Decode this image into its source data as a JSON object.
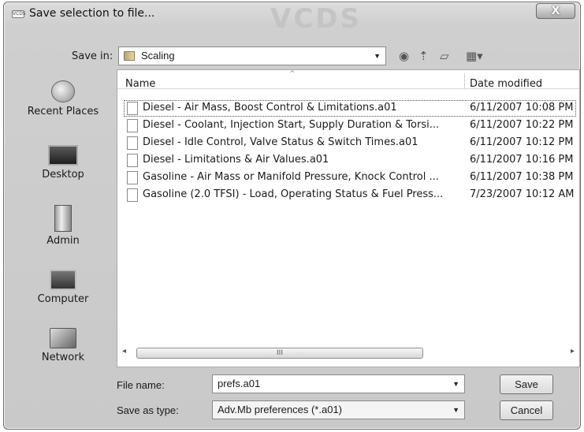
{
  "window": {
    "title": "Save selection to file...",
    "app_icon_text": "VCDS",
    "watermark": "VCDS",
    "close_label": "X"
  },
  "toolbar": {
    "save_in_label": "Save in:",
    "save_in_value": "Scaling",
    "icons": [
      "back-icon",
      "up-folder-icon",
      "new-folder-icon",
      "views-menu-icon"
    ]
  },
  "places": [
    {
      "label": "Recent Places",
      "icon": "recent-places-icon"
    },
    {
      "label": "Desktop",
      "icon": "desktop-icon"
    },
    {
      "label": "Admin",
      "icon": "user-folder-icon"
    },
    {
      "label": "Computer",
      "icon": "computer-icon"
    },
    {
      "label": "Network",
      "icon": "network-icon"
    }
  ],
  "list": {
    "columns": [
      "Name",
      "Date modified"
    ],
    "rows": [
      {
        "name": "Diesel - Air Mass, Boost Control & Limitations.a01",
        "date": "6/11/2007 10:08 PM",
        "selected": true
      },
      {
        "name": "Diesel - Coolant, Injection Start, Supply Duration & Torsi...",
        "date": "6/11/2007 10:22 PM"
      },
      {
        "name": "Diesel - Idle Control, Valve Status & Switch Times.a01",
        "date": "6/11/2007 10:12 PM"
      },
      {
        "name": "Diesel - Limitations & Air Values.a01",
        "date": "6/11/2007 10:16 PM"
      },
      {
        "name": "Gasoline - Air Mass or Manifold Pressure, Knock Control ...",
        "date": "6/11/2007 10:38 PM"
      },
      {
        "name": "Gasoline (2.0 TFSI) - Load, Operating Status & Fuel Press...",
        "date": "7/23/2007 10:12 AM"
      }
    ],
    "scroll_thumb_glyph": "III"
  },
  "form": {
    "file_name_label": "File name:",
    "file_name_value": "prefs.a01",
    "save_type_label": "Save as type:",
    "save_type_value": "Adv.Mb preferences (*.a01)",
    "save_button": "Save",
    "cancel_button": "Cancel"
  }
}
